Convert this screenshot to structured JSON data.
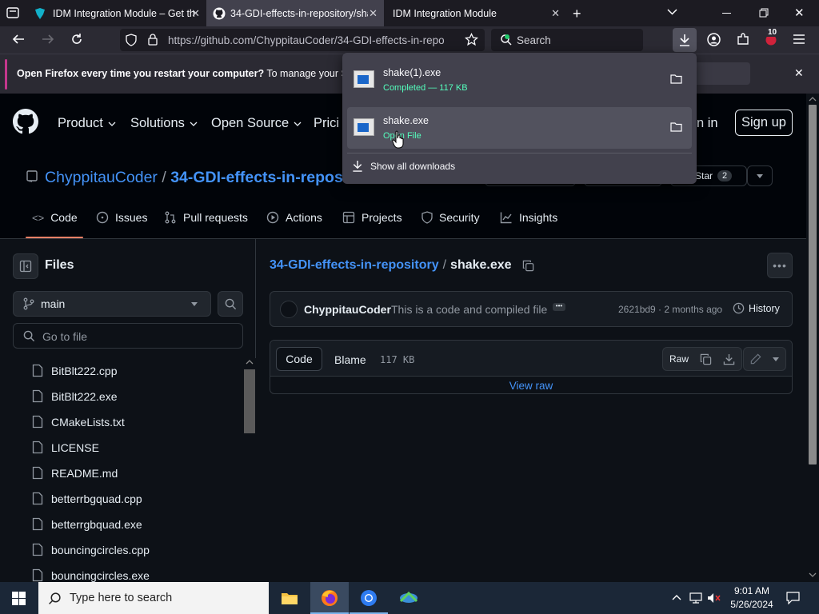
{
  "browser": {
    "tabs": [
      {
        "label": "IDM Integration Module – Get th"
      },
      {
        "label": "34-GDI-effects-in-repository/sha"
      },
      {
        "label": "IDM Integration Module"
      }
    ],
    "url": "https://github.com/ChyppitauCoder/34-GDI-effects-in-repo",
    "search_placeholder": "Search",
    "extension_badge": "10"
  },
  "notification": {
    "bold": "Open Firefox every time you restart your computer?",
    "text": "To manage your Start"
  },
  "downloads": {
    "items": [
      {
        "name": "shake(1).exe",
        "status": "Completed — 117 KB"
      },
      {
        "name": "shake.exe",
        "status": "Open File"
      }
    ],
    "show_all": "Show all downloads"
  },
  "github": {
    "nav": {
      "product": "Product",
      "solutions": "Solutions",
      "open_source": "Open Source",
      "pricing": "Prici",
      "sign_in": "n in",
      "sign_up": "Sign up"
    },
    "repo": {
      "owner": "ChyppitauCoder",
      "sep": "/",
      "name": "34-GDI-effects-in-repos",
      "star_label": "Star",
      "star_count": "2"
    },
    "tabs": [
      "Code",
      "Issues",
      "Pull requests",
      "Actions",
      "Projects",
      "Security",
      "Insights"
    ],
    "sidebar": {
      "title": "Files",
      "branch": "main",
      "goto_placeholder": "Go to file",
      "files": [
        "BitBlt222.cpp",
        "BitBlt222.exe",
        "CMakeLists.txt",
        "LICENSE",
        "README.md",
        "betterrbgquad.cpp",
        "betterrgbquad.exe",
        "bouncingcircles.cpp",
        "bouncingcircles.exe"
      ]
    },
    "breadcrumb": {
      "repo": "34-GDI-effects-in-repository",
      "sep": "/",
      "file": "shake.exe"
    },
    "commit": {
      "author": "ChyppitauCoder",
      "message": "This is a code and compiled file",
      "hash_time": "2621bd9 · 2 months ago",
      "history": "History"
    },
    "fileview": {
      "code": "Code",
      "blame": "Blame",
      "size": "117 KB",
      "raw": "Raw",
      "view_raw": "View raw"
    }
  },
  "taskbar": {
    "search_placeholder": "Type here to search",
    "time": "9:01 AM",
    "date": "5/26/2024"
  }
}
